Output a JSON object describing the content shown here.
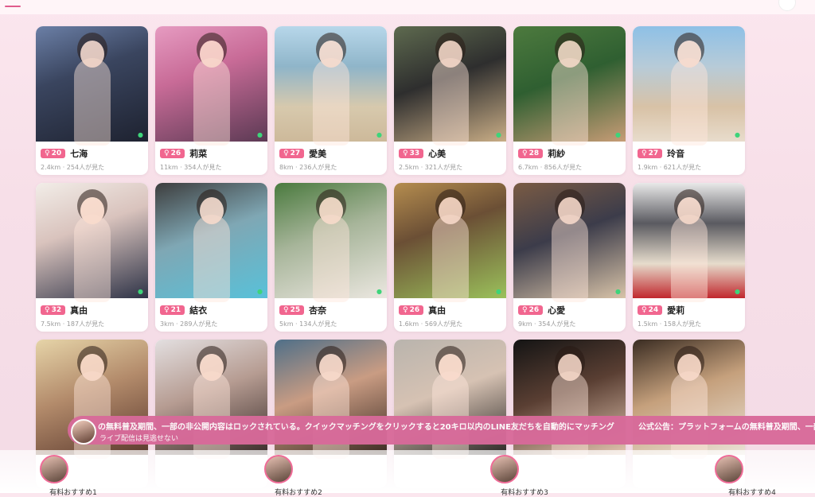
{
  "cards": [
    {
      "age": "20",
      "name": "七海",
      "distance": "2.4km",
      "views": "254人が見た"
    },
    {
      "age": "26",
      "name": "莉菜",
      "distance": "11km",
      "views": "354人が見た"
    },
    {
      "age": "27",
      "name": "愛美",
      "distance": "8km",
      "views": "236人が見た"
    },
    {
      "age": "33",
      "name": "心美",
      "distance": "2.5km",
      "views": "321人が見た"
    },
    {
      "age": "28",
      "name": "莉紗",
      "distance": "6.7km",
      "views": "856人が見た"
    },
    {
      "age": "27",
      "name": "玲音",
      "distance": "1.9km",
      "views": "621人が見た"
    },
    {
      "age": "32",
      "name": "真由",
      "distance": "7.5km",
      "views": "187人が見た"
    },
    {
      "age": "21",
      "name": "結衣",
      "distance": "3km",
      "views": "289人が見た"
    },
    {
      "age": "25",
      "name": "杏奈",
      "distance": "5km",
      "views": "134人が見た"
    },
    {
      "age": "26",
      "name": "真由",
      "distance": "1.6km",
      "views": "569人が見た"
    },
    {
      "age": "26",
      "name": "心愛",
      "distance": "9km",
      "views": "354人が見た"
    },
    {
      "age": "24",
      "name": "愛莉",
      "distance": "1.5km",
      "views": "158人が見た"
    },
    {
      "age": "",
      "name": "",
      "distance": "",
      "views": ""
    },
    {
      "age": "",
      "name": "",
      "distance": "",
      "views": ""
    },
    {
      "age": "",
      "name": "",
      "distance": "",
      "views": ""
    },
    {
      "age": "",
      "name": "",
      "distance": "",
      "views": ""
    },
    {
      "age": "",
      "name": "",
      "distance": "",
      "views": ""
    },
    {
      "age": "",
      "name": "",
      "distance": "",
      "views": ""
    }
  ],
  "female_symbol": "♀",
  "online_dot": "●",
  "marquee": {
    "line1": "の無料普及期間、一部の非公開内容はロックされている。クイックマッチングをクリックすると20キロ以内のLINE友だちを自動的にマッチング",
    "line1b": "公式公告：プラットフォームの無料普及期間、一部",
    "line2": "ライブ配信は見逃せない"
  },
  "bottom_nav": [
    {
      "label": "有料おすすめ1"
    },
    {
      "label": "有料おすすめ2"
    },
    {
      "label": "有料おすすめ3"
    },
    {
      "label": "有料おすすめ4"
    }
  ],
  "colors": {
    "accent": "#f1668f",
    "online": "#3ed47a",
    "marquee_bg": "#d86a9a"
  }
}
